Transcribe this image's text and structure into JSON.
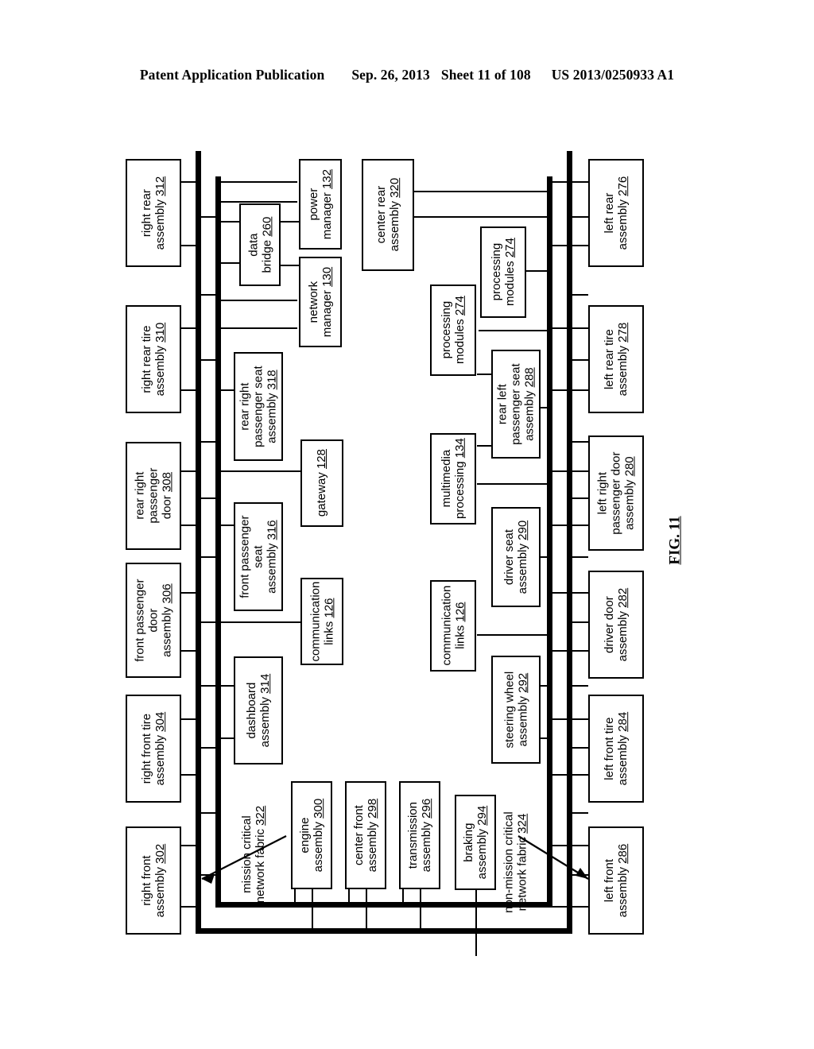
{
  "header": {
    "publication": "Patent Application Publication",
    "date": "Sep. 26, 2013",
    "sheet": "Sheet 11 of 108",
    "number": "US 2013/0250933 A1"
  },
  "figure": {
    "caption": "FIG. 11"
  },
  "annotations": [
    {
      "id": "fabric-mc",
      "text_line1": "mission critical",
      "text_line2": "network fabric",
      "ref": "322"
    },
    {
      "id": "fabric-nmc",
      "text_line1": "non-mission critical",
      "text_line2": "network fabric",
      "ref": "324"
    }
  ],
  "right_side_assemblies": [
    {
      "id": "n312",
      "lines": [
        "right rear",
        "assembly"
      ],
      "ref": "312"
    },
    {
      "id": "n310",
      "lines": [
        "right rear tire",
        "assembly"
      ],
      "ref": "310"
    },
    {
      "id": "n308",
      "lines": [
        "rear right",
        "passenger",
        "door"
      ],
      "ref": "308"
    },
    {
      "id": "n306",
      "lines": [
        "front passenger",
        "door",
        "assembly"
      ],
      "ref": "306"
    },
    {
      "id": "n304",
      "lines": [
        "right front tire",
        "assembly"
      ],
      "ref": "304"
    },
    {
      "id": "n302",
      "lines": [
        "right front",
        "assembly"
      ],
      "ref": "302"
    }
  ],
  "left_side_assemblies": [
    {
      "id": "n276",
      "lines": [
        "left rear",
        "assembly"
      ],
      "ref": "276"
    },
    {
      "id": "n278",
      "lines": [
        "left rear tire",
        "assembly"
      ],
      "ref": "278"
    },
    {
      "id": "n280",
      "lines": [
        "left right",
        "passenger door",
        "assembly"
      ],
      "ref": "280"
    },
    {
      "id": "n282",
      "lines": [
        "driver door",
        "assembly"
      ],
      "ref": "282"
    },
    {
      "id": "n284",
      "lines": [
        "left front tire",
        "assembly"
      ],
      "ref": "284"
    },
    {
      "id": "n286",
      "lines": [
        "left front",
        "assembly"
      ],
      "ref": "286"
    }
  ],
  "inner_left_column": [
    {
      "id": "n260",
      "lines": [
        "data",
        "bridge"
      ],
      "ref": "260"
    },
    {
      "id": "n318",
      "lines": [
        "rear right",
        "passenger seat",
        "assembly"
      ],
      "ref": "318"
    },
    {
      "id": "n316",
      "lines": [
        "front passenger",
        "seat",
        "assembly"
      ],
      "ref": "316"
    },
    {
      "id": "n314",
      "lines": [
        "dashboard",
        "assembly"
      ],
      "ref": "314"
    }
  ],
  "inner_left_column_2": [
    {
      "id": "n132",
      "lines": [
        "power",
        "manager"
      ],
      "ref": "132"
    },
    {
      "id": "n130",
      "lines": [
        "network",
        "manager"
      ],
      "ref": "130"
    },
    {
      "id": "n128",
      "lines": [
        "gateway"
      ],
      "ref": "128"
    },
    {
      "id": "n126a",
      "lines": [
        "communication",
        "links"
      ],
      "ref": "126"
    }
  ],
  "bottom_modules": [
    {
      "id": "n300",
      "lines": [
        "engine",
        "assembly"
      ],
      "ref": "300"
    },
    {
      "id": "n298",
      "lines": [
        "center front",
        "assembly"
      ],
      "ref": "298"
    },
    {
      "id": "n296",
      "lines": [
        "transmission",
        "assembly"
      ],
      "ref": "296"
    },
    {
      "id": "n294",
      "lines": [
        "braking",
        "assembly"
      ],
      "ref": "294"
    }
  ],
  "inner_right_column": [
    {
      "id": "n320",
      "lines": [
        "center rear",
        "assembly"
      ],
      "ref": "320"
    },
    {
      "id": "n274a",
      "lines": [
        "processing",
        "modules"
      ],
      "ref": "274"
    },
    {
      "id": "n134",
      "lines": [
        "multimedia",
        "processing"
      ],
      "ref": "134"
    },
    {
      "id": "n126b",
      "lines": [
        "communication",
        "links"
      ],
      "ref": "126"
    }
  ],
  "inner_right_column_2": [
    {
      "id": "n274b",
      "lines": [
        "processing",
        "modules"
      ],
      "ref": "274"
    },
    {
      "id": "n288",
      "lines": [
        "rear left",
        "passenger seat",
        "assembly"
      ],
      "ref": "288"
    },
    {
      "id": "n290",
      "lines": [
        "driver seat",
        "assembly"
      ],
      "ref": "290"
    },
    {
      "id": "n292",
      "lines": [
        "steering wheel",
        "assembly"
      ],
      "ref": "292"
    }
  ]
}
